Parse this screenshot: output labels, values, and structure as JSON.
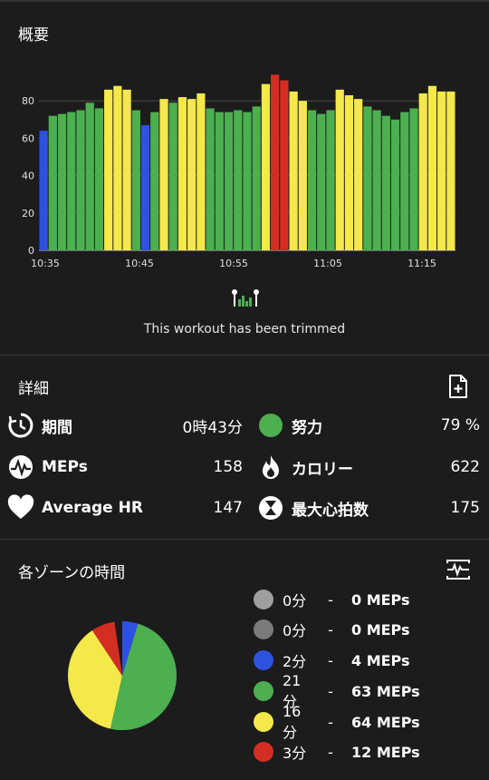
{
  "overview": {
    "title": "概要",
    "trimmed_note": "This workout has been trimmed"
  },
  "colors": {
    "blue": "#2e52e0",
    "green": "#4caf50",
    "yellow": "#f4e84a",
    "red": "#d42e22",
    "gray_light": "#9e9e9e",
    "gray_dark": "#7a7a7a"
  },
  "chart_data": {
    "type": "bar",
    "x_ticks": [
      "10:35",
      "10:45",
      "10:55",
      "11:05",
      "11:15"
    ],
    "y_ticks": [
      "0",
      "20",
      "40",
      "60",
      "80"
    ],
    "ylim": [
      0,
      100
    ],
    "grid": "horizontal",
    "bars": [
      {
        "v": 64,
        "z": "blue"
      },
      {
        "v": 72,
        "z": "green"
      },
      {
        "v": 73,
        "z": "green"
      },
      {
        "v": 74,
        "z": "green"
      },
      {
        "v": 75,
        "z": "green"
      },
      {
        "v": 79,
        "z": "green"
      },
      {
        "v": 76,
        "z": "green"
      },
      {
        "v": 86,
        "z": "yellow"
      },
      {
        "v": 88,
        "z": "yellow"
      },
      {
        "v": 86,
        "z": "yellow"
      },
      {
        "v": 75,
        "z": "green"
      },
      {
        "v": 67,
        "z": "blue"
      },
      {
        "v": 74,
        "z": "green"
      },
      {
        "v": 81,
        "z": "yellow"
      },
      {
        "v": 79,
        "z": "green"
      },
      {
        "v": 82,
        "z": "yellow"
      },
      {
        "v": 81,
        "z": "yellow"
      },
      {
        "v": 84,
        "z": "yellow"
      },
      {
        "v": 76,
        "z": "green"
      },
      {
        "v": 74,
        "z": "green"
      },
      {
        "v": 74,
        "z": "green"
      },
      {
        "v": 75,
        "z": "green"
      },
      {
        "v": 74,
        "z": "green"
      },
      {
        "v": 77,
        "z": "green"
      },
      {
        "v": 89,
        "z": "yellow"
      },
      {
        "v": 94,
        "z": "red"
      },
      {
        "v": 91,
        "z": "red"
      },
      {
        "v": 85,
        "z": "yellow"
      },
      {
        "v": 80,
        "z": "yellow"
      },
      {
        "v": 75,
        "z": "green"
      },
      {
        "v": 73,
        "z": "green"
      },
      {
        "v": 75,
        "z": "green"
      },
      {
        "v": 86,
        "z": "yellow"
      },
      {
        "v": 83,
        "z": "yellow"
      },
      {
        "v": 81,
        "z": "yellow"
      },
      {
        "v": 77,
        "z": "green"
      },
      {
        "v": 75,
        "z": "green"
      },
      {
        "v": 72,
        "z": "green"
      },
      {
        "v": 70,
        "z": "green"
      },
      {
        "v": 74,
        "z": "green"
      },
      {
        "v": 76,
        "z": "green"
      },
      {
        "v": 84,
        "z": "yellow"
      },
      {
        "v": 88,
        "z": "yellow"
      },
      {
        "v": 85,
        "z": "yellow"
      },
      {
        "v": 85,
        "z": "yellow"
      }
    ]
  },
  "details": {
    "title": "詳細",
    "stats": [
      {
        "icon": "timer-icon",
        "label": "期間",
        "value": "0時43分"
      },
      {
        "icon": "effort-dot-icon",
        "label": "努力",
        "value": "79 %"
      },
      {
        "icon": "meps-icon",
        "label": "MEPs",
        "value": "158"
      },
      {
        "icon": "flame-icon",
        "label": "カロリー",
        "value": "622"
      },
      {
        "icon": "heart-icon",
        "label": "Average HR",
        "value": "147"
      },
      {
        "icon": "hourglass-icon",
        "label": "最大心拍数",
        "value": "175"
      }
    ]
  },
  "zones": {
    "title": "各ゾーンの時間",
    "rows": [
      {
        "color": "gray_light",
        "mins": "0分",
        "dash": "-",
        "meps": "0 MEPs",
        "frac": 0
      },
      {
        "color": "gray_dark",
        "mins": "0分",
        "dash": "-",
        "meps": "0 MEPs",
        "frac": 0
      },
      {
        "color": "blue",
        "mins": "2分",
        "dash": "-",
        "meps": "4 MEPs",
        "frac": 0.047
      },
      {
        "color": "green",
        "mins": "21分",
        "dash": "-",
        "meps": "63 MEPs",
        "frac": 0.488
      },
      {
        "color": "yellow",
        "mins": "16分",
        "dash": "-",
        "meps": "64 MEPs",
        "frac": 0.372
      },
      {
        "color": "red",
        "mins": "3分",
        "dash": "-",
        "meps": "12 MEPs",
        "frac": 0.07
      }
    ]
  }
}
